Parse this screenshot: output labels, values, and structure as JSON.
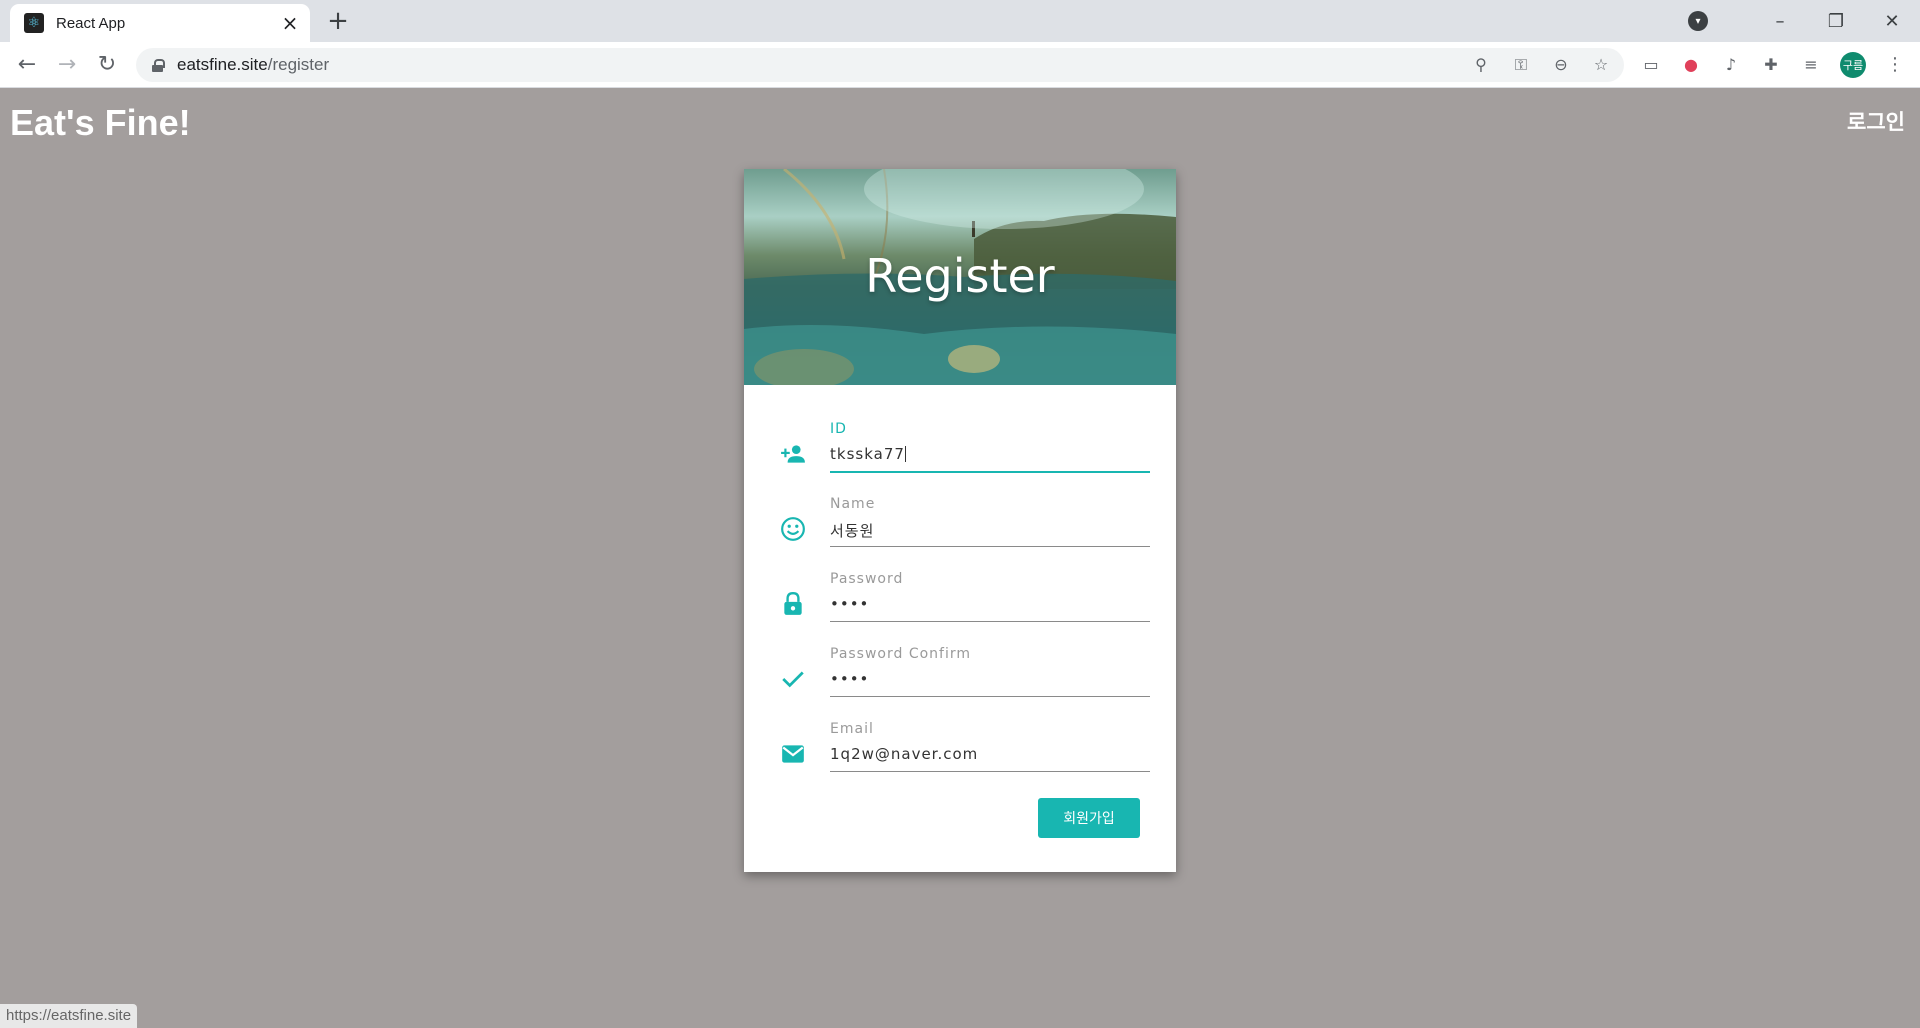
{
  "browser": {
    "tab_title": "React App",
    "new_tab_symbol": "+",
    "url_host": "eatsfine.site",
    "url_path": "/register",
    "profile_initials": "구름",
    "status_url": "https://eatsfine.site"
  },
  "site": {
    "logo": "Eat's Fine!",
    "login_link": "로그인"
  },
  "register": {
    "title": "Register",
    "fields": [
      {
        "label": "ID",
        "value": "tksska77",
        "icon": "add-person-icon",
        "active": true
      },
      {
        "label": "Name",
        "value": "서동원",
        "icon": "smiley-icon",
        "active": false
      },
      {
        "label": "Password",
        "value": "••••",
        "icon": "lock-icon",
        "active": false
      },
      {
        "label": "Password Confirm",
        "value": "••••",
        "icon": "check-icon",
        "active": false
      },
      {
        "label": "Email",
        "value": "1q2w@naver.com",
        "icon": "mail-icon",
        "active": false
      }
    ],
    "submit_label": "회원가입"
  },
  "colors": {
    "accent": "#18b6b1",
    "page_background": "#a39e9d"
  }
}
